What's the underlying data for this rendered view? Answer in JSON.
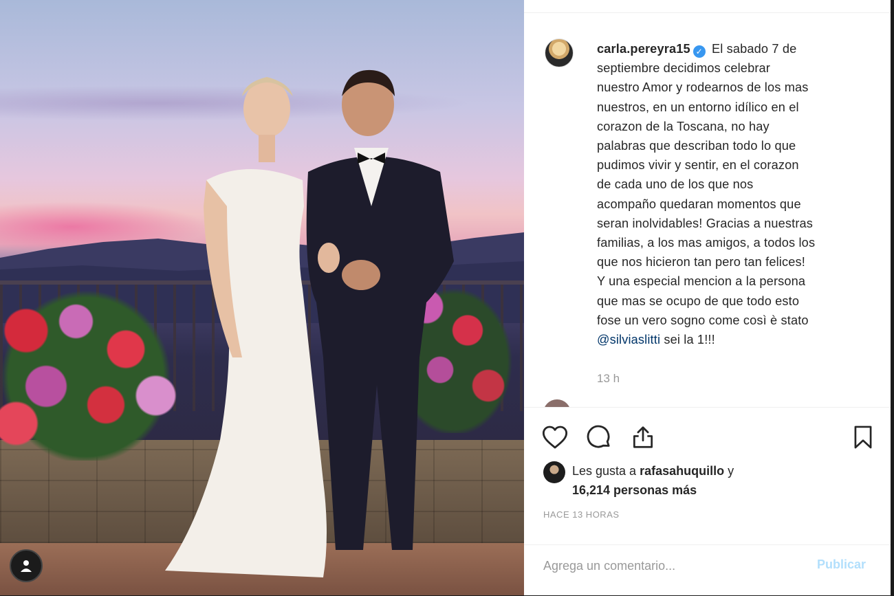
{
  "post": {
    "username": "carla.pereyra15",
    "verified_symbol": "✓",
    "caption_lines": [
      "El sabado 7 de",
      "septiembre decidimos celebrar",
      "nuestro Amor y rodearnos de los mas",
      "nuestros, en un entorno idílico en el",
      "corazon de la Toscana, no hay",
      "palabras que describan todo lo que",
      "pudimos vivir y sentir, en el corazon",
      "de cada uno de los que nos",
      "acompaño quedaran momentos que",
      "seran inolvidables! Gracias a nuestras",
      "familias, a los mas amigos, a todos los",
      "que nos hicieron tan pero tan felices!",
      "Y una especial mencion a la persona",
      "que mas se ocupo de que todo esto",
      "fose un vero sogno come così è stato"
    ],
    "mention": "@silviaslitti",
    "caption_end": " sei la 1!!!",
    "time_ago": "13 h",
    "likes_prefix": "Les gusta a ",
    "likes_user": "rafasahuquillo",
    "likes_connector": " y",
    "likes_count": "16,214 personas más",
    "timestamp": "HACE 13 HORAS",
    "comment_placeholder": "Agrega un comentario...",
    "publish_label": "Publicar"
  },
  "icons": {
    "like": "heart-icon",
    "comment": "comment-icon",
    "share": "share-icon",
    "save": "bookmark-icon",
    "profile": "person-icon"
  },
  "colors": {
    "verified": "#3897f0",
    "publish_disabled": "#b2dffc",
    "text": "#262626",
    "muted": "#999999"
  }
}
